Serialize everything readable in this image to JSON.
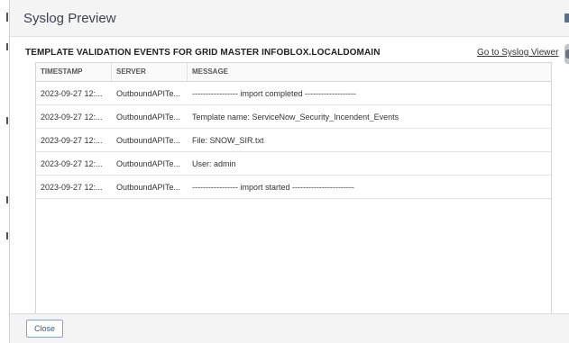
{
  "dialog": {
    "title": "Syslog Preview"
  },
  "panel": {
    "heading": "TEMPLATE VALIDATION EVENTS FOR GRID MASTER INFOBLOX.LOCALDOMAIN",
    "viewer_link": "Go to Syslog Viewer"
  },
  "table": {
    "columns": [
      "TIMESTAMP",
      "SERVER",
      "MESSAGE"
    ],
    "rows": [
      {
        "timestamp": "2023-09-27 12:...",
        "server": "OutboundAPITe...",
        "message": "----------------- import completed -------------------"
      },
      {
        "timestamp": "2023-09-27 12:...",
        "server": "OutboundAPITe...",
        "message": "Template name: ServiceNow_Security_Incendent_Events"
      },
      {
        "timestamp": "2023-09-27 12:...",
        "server": "OutboundAPITe...",
        "message": "File: SNOW_SIR.txt"
      },
      {
        "timestamp": "2023-09-27 12:...",
        "server": "OutboundAPITe...",
        "message": "User: admin"
      },
      {
        "timestamp": "2023-09-27 12:...",
        "server": "OutboundAPITe...",
        "message": "----------------- import started -----------------------"
      }
    ]
  },
  "footer": {
    "close_label": "Close"
  }
}
